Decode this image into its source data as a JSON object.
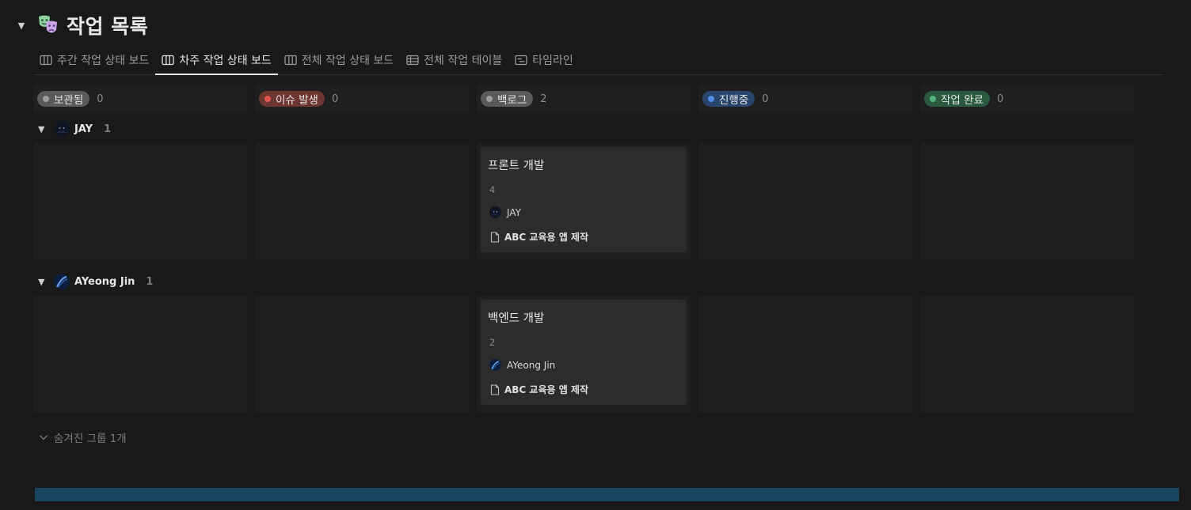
{
  "database": {
    "title": "작업 목록",
    "icon": "theater-masks-icon"
  },
  "tabs": [
    {
      "label": "주간 작업 상태 보드",
      "icon": "board-icon",
      "active": false
    },
    {
      "label": "차주 작업 상태 보드",
      "icon": "board-icon",
      "active": true
    },
    {
      "label": "전체 작업 상태 보드",
      "icon": "board-icon",
      "active": false
    },
    {
      "label": "전체 작업 테이블",
      "icon": "table-icon",
      "active": false
    },
    {
      "label": "타임라인",
      "icon": "timeline-icon",
      "active": false
    }
  ],
  "columns": [
    {
      "label": "보관됨",
      "count": "0",
      "pill_color": "#5a5a5a",
      "dot_color": "#9b9b9b"
    },
    {
      "label": "이슈 발생",
      "count": "0",
      "pill_color": "#6e3630",
      "dot_color": "#e0584b"
    },
    {
      "label": "백로그",
      "count": "2",
      "pill_color": "#5a5a5a",
      "dot_color": "#9b9b9b"
    },
    {
      "label": "진행중",
      "count": "0",
      "pill_color": "#28456c",
      "dot_color": "#4f8ee6"
    },
    {
      "label": "작업 완료",
      "count": "0",
      "pill_color": "#2b593f",
      "dot_color": "#4fb57a"
    }
  ],
  "groups": [
    {
      "name": "JAY",
      "count": "1",
      "card": {
        "title": "프론트 개발",
        "number": "4",
        "person": "JAY",
        "relation": "ABC 교육용 앱 제작"
      }
    },
    {
      "name": "AYeong Jin",
      "count": "1",
      "card": {
        "title": "백엔드 개발",
        "number": "2",
        "person": "AYeong Jin",
        "relation": "ABC 교육용 앱 제작"
      }
    }
  ],
  "hidden_groups_label": "숨겨진 그룹 1개"
}
